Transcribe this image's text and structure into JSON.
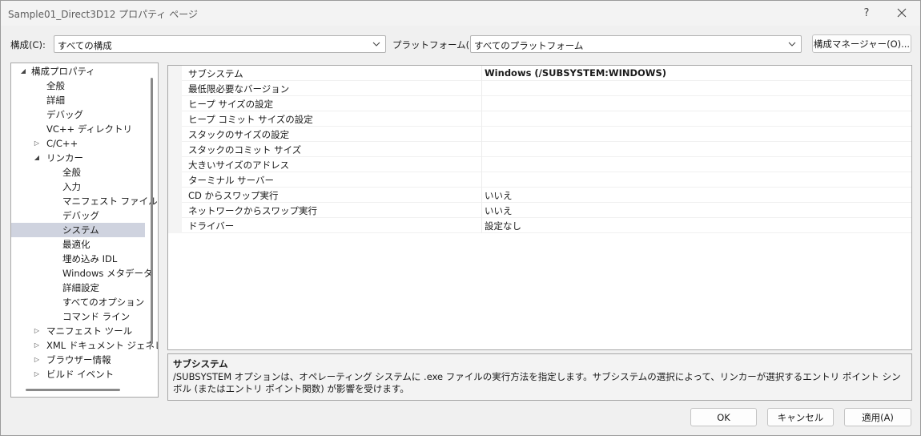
{
  "window": {
    "title": "Sample01_Direct3D12 プロパティ ページ",
    "help_glyph": "?",
    "close_glyph": "✕"
  },
  "toolbar": {
    "config_label": "構成(C):",
    "config_value": "すべての構成",
    "platform_label": "プラットフォーム(P):",
    "platform_value": "すべてのプラットフォーム",
    "config_manager_label": "構成マネージャー(O)..."
  },
  "tree": {
    "items": [
      {
        "label": "構成プロパティ",
        "expander": "◢"
      },
      {
        "label": "全般",
        "expander": ""
      },
      {
        "label": "詳細",
        "expander": ""
      },
      {
        "label": "デバッグ",
        "expander": ""
      },
      {
        "label": "VC++ ディレクトリ",
        "expander": ""
      },
      {
        "label": "C/C++",
        "expander": "▷"
      },
      {
        "label": "リンカー",
        "expander": "◢"
      },
      {
        "label": "全般",
        "expander": ""
      },
      {
        "label": "入力",
        "expander": ""
      },
      {
        "label": "マニフェスト ファイル",
        "expander": ""
      },
      {
        "label": "デバッグ",
        "expander": ""
      },
      {
        "label": "システム",
        "expander": ""
      },
      {
        "label": "最適化",
        "expander": ""
      },
      {
        "label": "埋め込み IDL",
        "expander": ""
      },
      {
        "label": "Windows メタデータ",
        "expander": ""
      },
      {
        "label": "詳細設定",
        "expander": ""
      },
      {
        "label": "すべてのオプション",
        "expander": ""
      },
      {
        "label": "コマンド ライン",
        "expander": ""
      },
      {
        "label": "マニフェスト ツール",
        "expander": "▷"
      },
      {
        "label": "XML ドキュメント ジェネレー",
        "expander": "▷"
      },
      {
        "label": "ブラウザー情報",
        "expander": "▷"
      },
      {
        "label": "ビルド イベント",
        "expander": "▷"
      }
    ]
  },
  "grid": {
    "rows": [
      {
        "name": "サブシステム",
        "value": "Windows (/SUBSYSTEM:WINDOWS)"
      },
      {
        "name": "最低限必要なバージョン",
        "value": ""
      },
      {
        "name": "ヒープ サイズの設定",
        "value": ""
      },
      {
        "name": "ヒープ コミット サイズの設定",
        "value": ""
      },
      {
        "name": "スタックのサイズの設定",
        "value": ""
      },
      {
        "name": "スタックのコミット サイズ",
        "value": ""
      },
      {
        "name": "大きいサイズのアドレス",
        "value": ""
      },
      {
        "name": "ターミナル サーバー",
        "value": ""
      },
      {
        "name": "CD からスワップ実行",
        "value": "いいえ"
      },
      {
        "name": "ネットワークからスワップ実行",
        "value": "いいえ"
      },
      {
        "name": "ドライバー",
        "value": "設定なし"
      }
    ]
  },
  "description": {
    "title": "サブシステム",
    "text": "/SUBSYSTEM オプションは、オペレーティング システムに .exe ファイルの実行方法を指定します。サブシステムの選択によって、リンカーが選択するエントリ ポイント シンボル (またはエントリ ポイント関数) が影響を受けます。"
  },
  "buttons": {
    "ok": "OK",
    "cancel": "キャンセル",
    "apply": "適用(A)"
  },
  "colors": {
    "selection": "#cfd3df",
    "window_bg": "#f0f0f0"
  }
}
